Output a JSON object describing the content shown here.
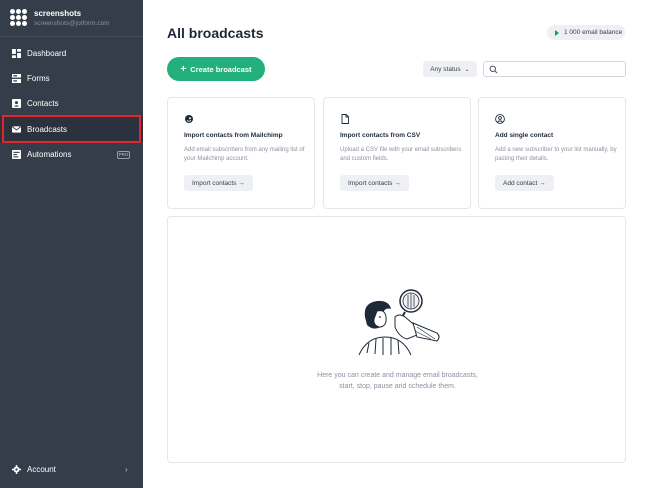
{
  "sidebar": {
    "brand_name": "screenshots",
    "brand_email": "screenshots@jotform.com",
    "items": [
      {
        "label": "Dashboard"
      },
      {
        "label": "Forms"
      },
      {
        "label": "Contacts"
      },
      {
        "label": "Broadcasts"
      },
      {
        "label": "Automations",
        "badge": "PRO"
      }
    ],
    "account_label": "Account",
    "active_item": "Broadcasts"
  },
  "header": {
    "title": "All broadcasts",
    "balance": "1 000 email balance"
  },
  "toolbar": {
    "create_label": "Create broadcast",
    "status_label": "Any status",
    "search_placeholder": ""
  },
  "cards": [
    {
      "icon": "mailchimp-icon",
      "title": "Import contacts from Mailchimp",
      "desc": "Add email subscribers from any mailing list of your Mailchimp account.",
      "button": "Import contacts →"
    },
    {
      "icon": "file-icon",
      "title": "Import contacts from CSV",
      "desc": "Upload a CSV file with your email subscribers and custom fields.",
      "button": "Import contacts →"
    },
    {
      "icon": "user-circle-icon",
      "title": "Add single contact",
      "desc": "Add a new subscriber to your list manually, by pasting their details.",
      "button": "Add contact →"
    }
  ],
  "empty_state": {
    "line1": "Here you can create and manage email broadcasts,",
    "line2": "start, stop, pause and schedule them."
  },
  "colors": {
    "sidebar_bg": "#353c4a",
    "accent": "#22b07d",
    "highlight": "#e0262a"
  }
}
